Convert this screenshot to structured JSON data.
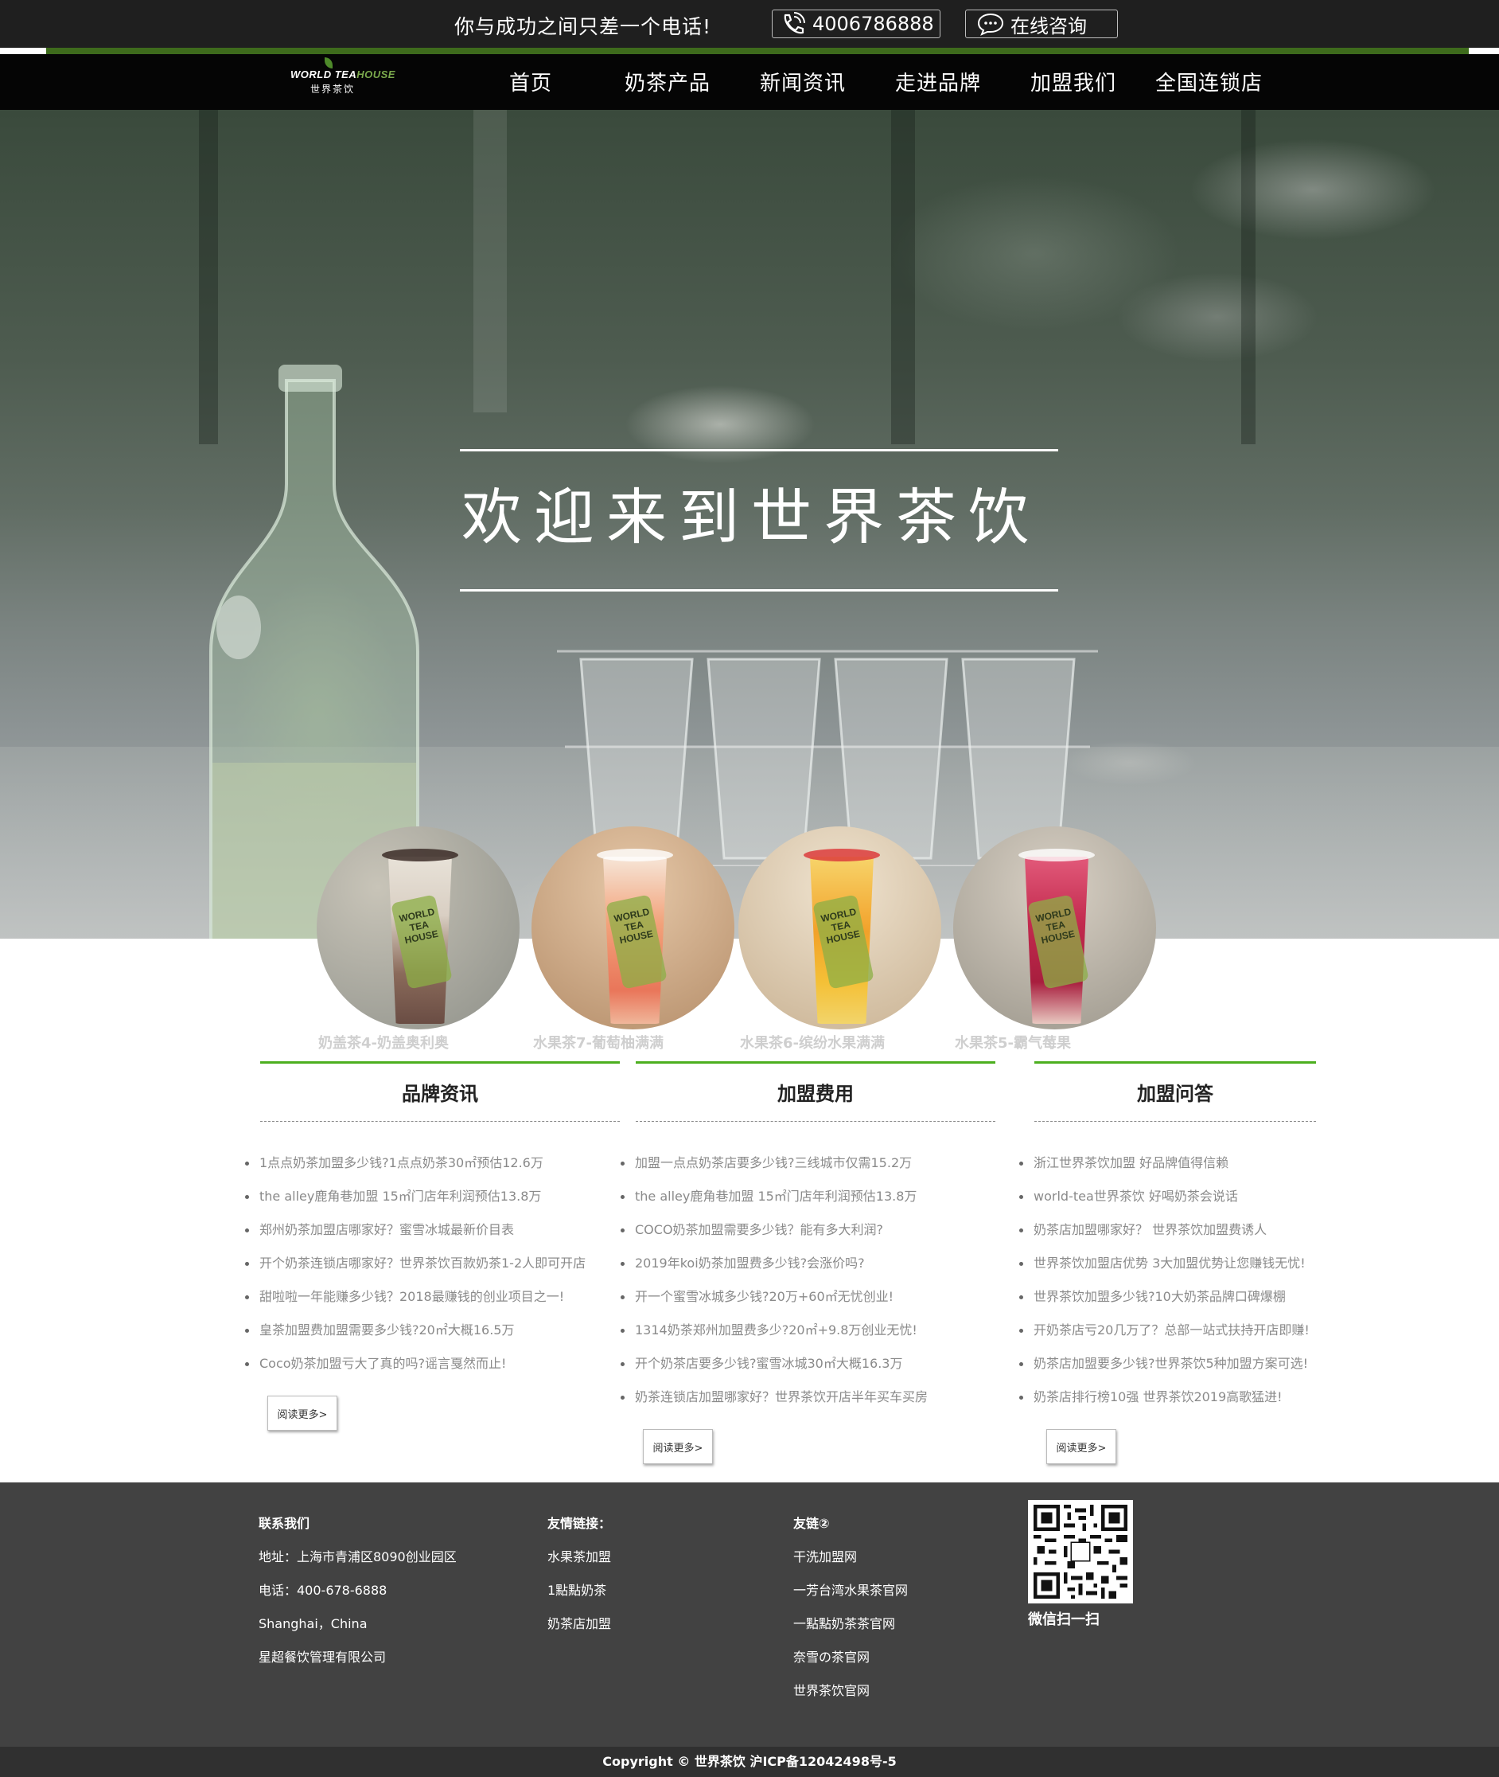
{
  "topbar": {
    "slogan": "你与成功之间只差一个电话!",
    "phone": "4006786888",
    "chat_label": "在线咨询",
    "phone_icon": "phone-icon",
    "chat_icon": "chat-bubble-icon"
  },
  "logo": {
    "en_a": "WORLD TEA",
    "en_b": "HOUSE",
    "cn": "世界茶饮"
  },
  "nav": [
    "首页",
    "奶茶产品",
    "新闻资讯",
    "走进品牌",
    "加盟我们",
    "全国连锁店"
  ],
  "hero": {
    "title": "欢迎来到世界茶饮"
  },
  "products": [
    {
      "name": "奶盖茶4-奶盖奥利奥"
    },
    {
      "name": "水果茶7-葡萄柚满满"
    },
    {
      "name": "水果茶6-缤纷水果满满"
    },
    {
      "name": "水果茶5-霸气莓果"
    }
  ],
  "columns": [
    {
      "title": "品牌资讯",
      "items": [
        "1点点奶茶加盟多少钱?1点点奶茶30㎡预估12.6万",
        "the alley鹿角巷加盟 15㎡门店年利润预估13.8万",
        "郑州奶茶加盟店哪家好？蜜雪冰城最新价目表",
        "开个奶茶连锁店哪家好？世界茶饮百款奶茶1-2人即可开店",
        "甜啦啦一年能赚多少钱？2018最赚钱的创业项目之一!",
        "皇茶加盟费加盟需要多少钱?20㎡大概16.5万",
        "Coco奶茶加盟亏大了真的吗?谣言戛然而止!"
      ],
      "more": "阅读更多>"
    },
    {
      "title": "加盟费用",
      "items": [
        "加盟一点点奶茶店要多少钱?三线城市仅需15.2万",
        "the alley鹿角巷加盟 15㎡门店年利润预估13.8万",
        "COCO奶茶加盟需要多少钱？能有多大利润?",
        "2019年koi奶茶加盟费多少钱?会涨价吗?",
        "开一个蜜雪冰城多少钱?20万+60㎡无忧创业!",
        "1314奶茶郑州加盟费多少?20㎡+9.8万创业无忧!",
        "开个奶茶店要多少钱?蜜雪冰城30㎡大概16.3万",
        "奶茶连锁店加盟哪家好？世界茶饮开店半年买车买房"
      ],
      "more": "阅读更多>"
    },
    {
      "title": "加盟问答",
      "items": [
        "浙江世界茶饮加盟 好品牌值得信赖",
        "world-tea世界茶饮 好喝奶茶会说话",
        "奶茶店加盟哪家好？ 世界茶饮加盟费诱人",
        "世界茶饮加盟店优势 3大加盟优势让您赚钱无忧!",
        "世界茶饮加盟多少钱?10大奶茶品牌口碑爆棚",
        "开奶茶店亏20几万了？总部一站式扶持开店即赚!",
        "奶茶店加盟要多少钱?世界茶饮5种加盟方案可选!",
        "奶茶店排行榜10强 世界茶饮2019高歌猛进!"
      ],
      "more": "阅读更多>"
    }
  ],
  "footer": {
    "contact": {
      "title": "联系我们",
      "lines": [
        "地址：上海市青浦区8090创业园区",
        "电话：400-678-6888",
        "Shanghai，China",
        "星超餐饮管理有限公司"
      ]
    },
    "links1": {
      "title": "友情链接：",
      "items": [
        "水果茶加盟",
        "1點點奶茶",
        "奶茶店加盟"
      ]
    },
    "links2": {
      "title": "友链②",
      "items": [
        "干洗加盟网",
        "一芳台湾水果茶官网",
        "一點點奶茶茶官网",
        "奈雪の茶官网",
        "世界茶饮官网"
      ]
    },
    "qr_label": "微信扫一扫",
    "copyright": "Copyright © 世界茶饮 沪ICP备12042498号-5"
  },
  "colors": {
    "accent_green": "#4caf1f",
    "nav_green": "#3e6b1c",
    "footer_bg": "#424242"
  }
}
